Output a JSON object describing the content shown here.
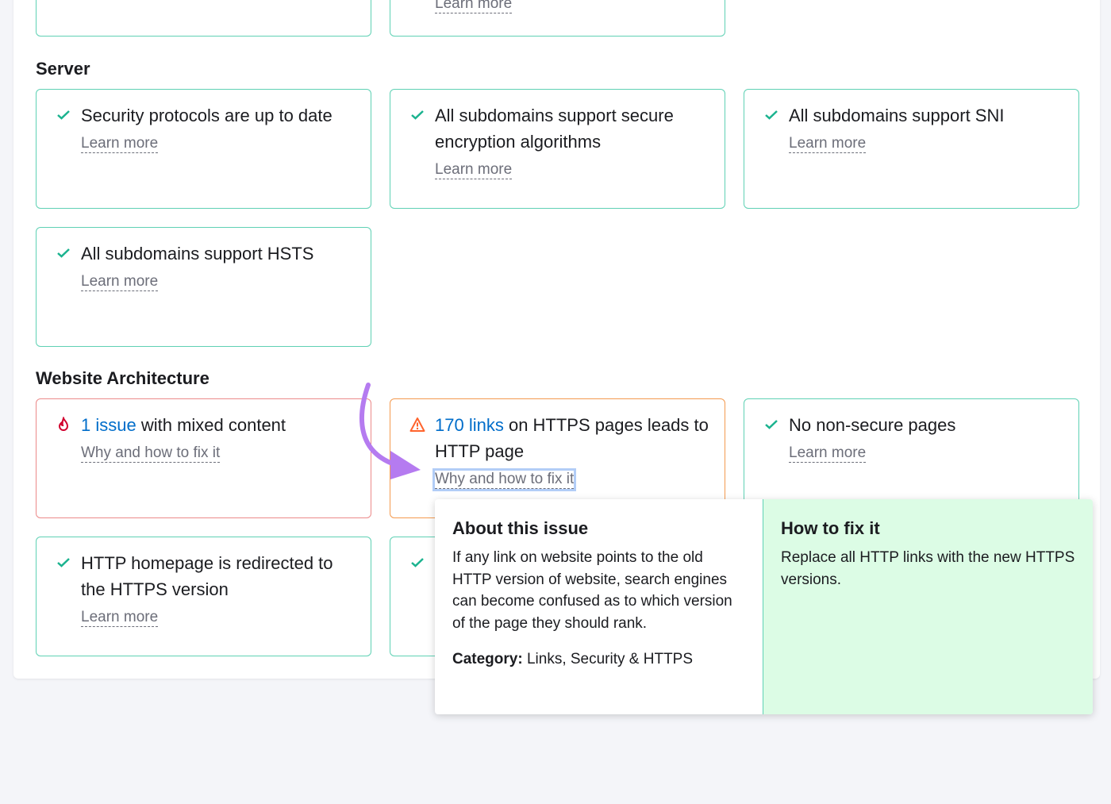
{
  "top_cards": {
    "learn_more": "Learn more"
  },
  "server": {
    "heading": "Server",
    "cards": [
      {
        "title": "Security protocols are up to date",
        "link": "Learn more"
      },
      {
        "title": "All subdomains support secure encryption algorithms",
        "link": "Learn more"
      },
      {
        "title": "All subdomains support SNI",
        "link": "Learn more"
      },
      {
        "title": "All subdomains support HSTS",
        "link": "Learn more"
      }
    ]
  },
  "architecture": {
    "heading": "Website Architecture",
    "cards": [
      {
        "count": "1 issue",
        "title": " with mixed content",
        "link": "Why and how to fix it",
        "status": "error"
      },
      {
        "count": "170 links",
        "title": " on HTTPS pages leads to HTTP page",
        "link": "Why and how to fix it",
        "status": "warning"
      },
      {
        "title": "No non-secure pages",
        "link": "Learn more"
      },
      {
        "title": "HTTP homepage is redirected to the HTTPS version",
        "link": "Learn more"
      },
      {
        "status": "ok"
      }
    ]
  },
  "popup": {
    "about_title": "About this issue",
    "about_text": "If any link on website points to the old HTTP version of website, search engines can become confused as to which version of the page they should rank.",
    "category_label": "Category:",
    "category_value": " Links, Security & HTTPS",
    "fix_title": "How to fix it",
    "fix_text": "Replace all HTTP links with the new HTTPS versions."
  },
  "colors": {
    "ok": "#1bb38f",
    "error": "#d1002f",
    "warning": "#ff642d",
    "link": "#006dca",
    "annotation_arrow": "#b57bf0"
  }
}
